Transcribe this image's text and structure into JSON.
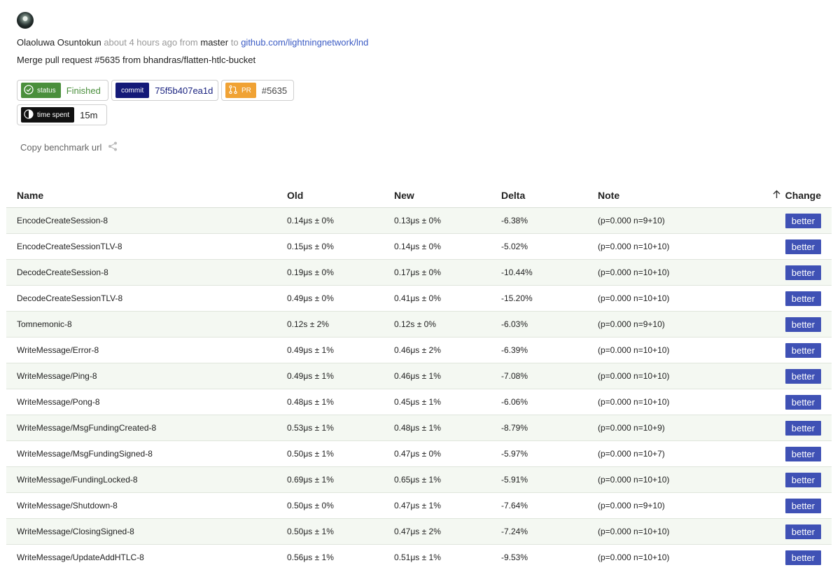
{
  "header": {
    "author": "Olaoluwa Osuntokun",
    "time_ago": "about 4 hours ago",
    "from_word": "from",
    "branch": "master",
    "to_word": "to",
    "repo": "github.com/lightningnetwork/lnd",
    "commit_message": "Merge pull request #5635 from bhandras/flatten-htlc-bucket"
  },
  "chips": {
    "status_label": "status",
    "status_value": "Finished",
    "commit_label": "commit",
    "commit_value": "75f5b407ea1d",
    "pr_label": "PR",
    "pr_value": "#5635",
    "time_label": "time spent",
    "time_value": "15m"
  },
  "copy_url": "Copy benchmark url",
  "table": {
    "headers": {
      "name": "Name",
      "old": "Old",
      "new": "New",
      "delta": "Delta",
      "note": "Note",
      "change": "Change"
    },
    "rows": [
      {
        "name": "EncodeCreateSession-8",
        "old": "0.14μs ± 0%",
        "new": "0.13μs ± 0%",
        "delta": "-6.38%",
        "note": "(p=0.000 n=9+10)",
        "change": "better"
      },
      {
        "name": "EncodeCreateSessionTLV-8",
        "old": "0.15μs ± 0%",
        "new": "0.14μs ± 0%",
        "delta": "-5.02%",
        "note": "(p=0.000 n=10+10)",
        "change": "better"
      },
      {
        "name": "DecodeCreateSession-8",
        "old": "0.19μs ± 0%",
        "new": "0.17μs ± 0%",
        "delta": "-10.44%",
        "note": "(p=0.000 n=10+10)",
        "change": "better"
      },
      {
        "name": "DecodeCreateSessionTLV-8",
        "old": "0.49μs ± 0%",
        "new": "0.41μs ± 0%",
        "delta": "-15.20%",
        "note": "(p=0.000 n=10+10)",
        "change": "better"
      },
      {
        "name": "Tomnemonic-8",
        "old": "0.12s ± 2%",
        "new": "0.12s ± 0%",
        "delta": "-6.03%",
        "note": "(p=0.000 n=9+10)",
        "change": "better"
      },
      {
        "name": "WriteMessage/Error-8",
        "old": "0.49μs ± 1%",
        "new": "0.46μs ± 2%",
        "delta": "-6.39%",
        "note": "(p=0.000 n=10+10)",
        "change": "better"
      },
      {
        "name": "WriteMessage/Ping-8",
        "old": "0.49μs ± 1%",
        "new": "0.46μs ± 1%",
        "delta": "-7.08%",
        "note": "(p=0.000 n=10+10)",
        "change": "better"
      },
      {
        "name": "WriteMessage/Pong-8",
        "old": "0.48μs ± 1%",
        "new": "0.45μs ± 1%",
        "delta": "-6.06%",
        "note": "(p=0.000 n=10+10)",
        "change": "better"
      },
      {
        "name": "WriteMessage/MsgFundingCreated-8",
        "old": "0.53μs ± 1%",
        "new": "0.48μs ± 1%",
        "delta": "-8.79%",
        "note": "(p=0.000 n=10+9)",
        "change": "better"
      },
      {
        "name": "WriteMessage/MsgFundingSigned-8",
        "old": "0.50μs ± 1%",
        "new": "0.47μs ± 0%",
        "delta": "-5.97%",
        "note": "(p=0.000 n=10+7)",
        "change": "better"
      },
      {
        "name": "WriteMessage/FundingLocked-8",
        "old": "0.69μs ± 1%",
        "new": "0.65μs ± 1%",
        "delta": "-5.91%",
        "note": "(p=0.000 n=10+10)",
        "change": "better"
      },
      {
        "name": "WriteMessage/Shutdown-8",
        "old": "0.50μs ± 0%",
        "new": "0.47μs ± 1%",
        "delta": "-7.64%",
        "note": "(p=0.000 n=9+10)",
        "change": "better"
      },
      {
        "name": "WriteMessage/ClosingSigned-8",
        "old": "0.50μs ± 1%",
        "new": "0.47μs ± 2%",
        "delta": "-7.24%",
        "note": "(p=0.000 n=10+10)",
        "change": "better"
      },
      {
        "name": "WriteMessage/UpdateAddHTLC-8",
        "old": "0.56μs ± 1%",
        "new": "0.51μs ± 1%",
        "delta": "-9.53%",
        "note": "(p=0.000 n=10+10)",
        "change": "better"
      }
    ]
  },
  "colors": {
    "status_green": "#4a8f3c",
    "commit_navy": "#141a78",
    "pr_orange": "#f0a234",
    "better_blue": "#3f51b5",
    "link_blue": "#3b5bc4"
  }
}
